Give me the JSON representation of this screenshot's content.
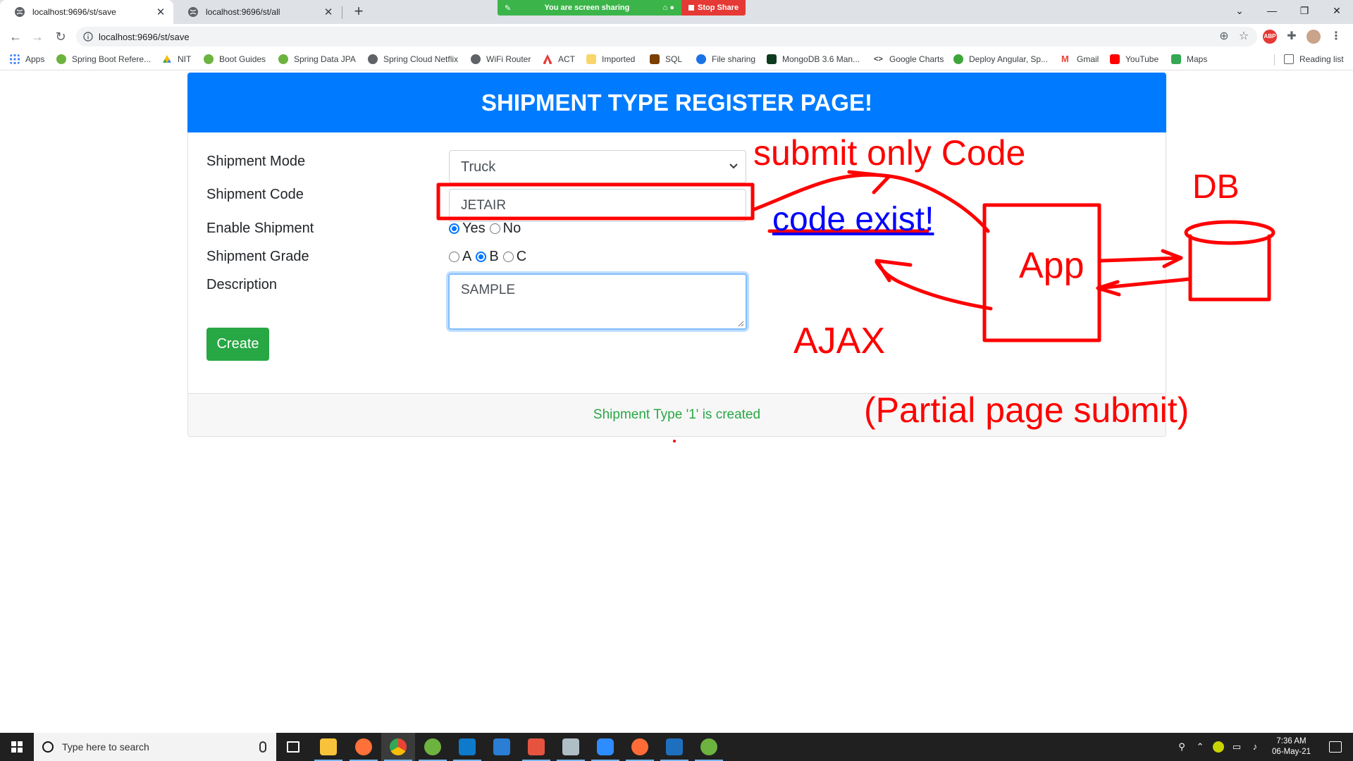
{
  "browser": {
    "tabs": [
      {
        "title": "localhost:9696/st/save",
        "active": true
      },
      {
        "title": "localhost:9696/st/all",
        "active": false
      }
    ],
    "new_tab": "+",
    "share": {
      "notice": "You are screen sharing",
      "stop": "Stop Share"
    },
    "url": "localhost:9696/st/save",
    "bookmarks": [
      {
        "label": "Apps",
        "icon": "apps-grid-icon",
        "color": "#4285f4"
      },
      {
        "label": "Spring Boot Refere...",
        "icon": "spring-icon",
        "color": "#6db33f"
      },
      {
        "label": "NIT",
        "icon": "drive-icon",
        "color": "#fbbc04"
      },
      {
        "label": "Boot Guides",
        "icon": "spring-icon",
        "color": "#6db33f"
      },
      {
        "label": "Spring Data JPA",
        "icon": "spring-icon",
        "color": "#6db33f"
      },
      {
        "label": "Spring Cloud Netflix",
        "icon": "globe-icon",
        "color": "#5f6368"
      },
      {
        "label": "WiFi Router",
        "icon": "globe-icon",
        "color": "#5f6368"
      },
      {
        "label": "ACT",
        "icon": "act-icon",
        "color": "#e53935"
      },
      {
        "label": "Imported",
        "icon": "folder-icon",
        "color": "#f9d66b"
      },
      {
        "label": "SQL",
        "icon": "sql-icon",
        "color": "#7b3f00"
      },
      {
        "label": "File sharing",
        "icon": "file-sharing-icon",
        "color": "#1a73e8"
      },
      {
        "label": "MongoDB 3.6 Man...",
        "icon": "mongodb-icon",
        "color": "#13aa52"
      },
      {
        "label": "Google Charts",
        "icon": "code-icon",
        "color": "#5f6368"
      },
      {
        "label": "Deploy Angular, Sp...",
        "icon": "deploy-icon",
        "color": "#3ea639"
      },
      {
        "label": "Gmail",
        "icon": "gmail-icon",
        "color": "#ea4335"
      },
      {
        "label": "YouTube",
        "icon": "youtube-icon",
        "color": "#ff0000"
      },
      {
        "label": "Maps",
        "icon": "maps-icon",
        "color": "#34a853"
      }
    ],
    "reading_list": "Reading list"
  },
  "page": {
    "header": "SHIPMENT TYPE REGISTER PAGE!",
    "labels": {
      "mode": "Shipment Mode",
      "code": "Shipment Code",
      "enable": "Enable Shipment",
      "grade": "Shipment Grade",
      "description": "Description"
    },
    "mode_value": "Truck",
    "code_value": "JETAIR",
    "enable_options": [
      {
        "label": "Yes",
        "checked": true
      },
      {
        "label": "No",
        "checked": false
      }
    ],
    "grade_options": [
      {
        "label": "A",
        "checked": false
      },
      {
        "label": "B",
        "checked": true
      },
      {
        "label": "C",
        "checked": false
      }
    ],
    "description_value": "SAMPLE",
    "create_button": "Create",
    "footer_message": "Shipment Type '1' is created"
  },
  "annotations": {
    "submit_only_code": "submit only Code",
    "code_exist": "code exist!",
    "db": "DB",
    "app": "App",
    "ajax": "AJAX",
    "partial": "(Partial page submit)",
    "annotation_color": "#ff0000",
    "message_color": "#0000ff"
  },
  "taskbar": {
    "search_placeholder": "Type here to search",
    "time": "7:36 AM",
    "date": "06-May-21"
  }
}
